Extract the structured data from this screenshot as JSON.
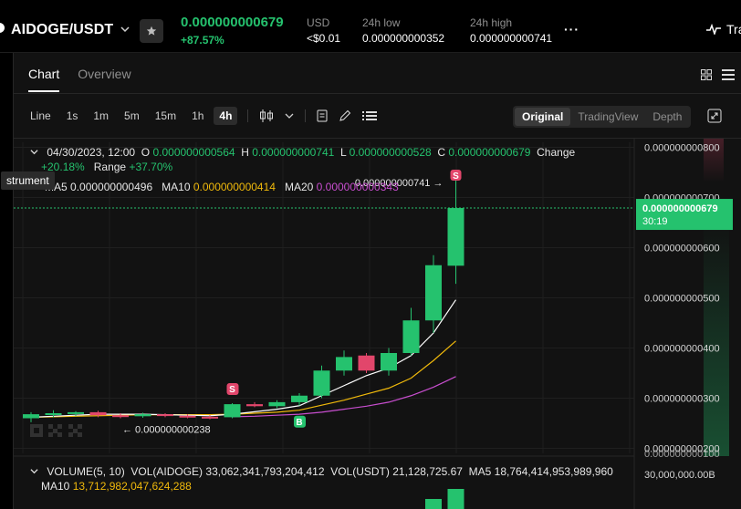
{
  "ticker": {
    "pair": "AIDOGE/USDT",
    "last_price": "0.000000000679",
    "change_pct": "+87.57%",
    "usd_label": "USD",
    "usd_value": "<$0.01",
    "low_label": "24h low",
    "low_value": "0.000000000352",
    "high_label": "24h high",
    "high_value": "0.000000000741",
    "more": "···",
    "trade_label": "Tra"
  },
  "tabs": [
    {
      "label": "Chart"
    },
    {
      "label": "Overview"
    }
  ],
  "toolbar": {
    "timeframes": [
      "Line",
      "1s",
      "1m",
      "5m",
      "15m",
      "1h",
      "4h"
    ],
    "active_timeframe": "4h"
  },
  "views": {
    "items": [
      "Original",
      "TradingView",
      "Depth"
    ],
    "active": "Original"
  },
  "legend": {
    "date": "04/30/2023, 12:00",
    "o_label": "O",
    "o_value": "0.000000000564",
    "h_label": "H",
    "h_value": "0.000000000741",
    "l_label": "L",
    "l_value": "0.000000000528",
    "c_label": "C",
    "c_value": "0.000000000679",
    "change_label": "Change",
    "change_value": "+20.18%",
    "range_label": "Range",
    "range_value": "+37.70%",
    "ma5_label": "MA5",
    "ma5_value": "0.000000000496",
    "ma10_label": "MA10",
    "ma10_value": "0.000000000414",
    "ma20_label": "MA20",
    "ma20_value": "0.000000000343",
    "tooltip": "strument"
  },
  "annotations": {
    "high_marker": "0.000000000741 →",
    "low_marker": "← 0.000000000238",
    "sell_tag": "S",
    "buy_tag": "B"
  },
  "price_axis": {
    "ticks": [
      "0.000000000800",
      "0.000000000700",
      "0.000000000600",
      "0.000000000500",
      "0.000000000400",
      "0.000000000300",
      "0.000000000200"
    ],
    "current_price": "0.000000000679",
    "countdown": "30:19",
    "cut_tick": "0.000000000100"
  },
  "volume": {
    "title": "VOLUME(5, 10)",
    "vol_coin_label": "VOL(AIDOGE)",
    "vol_coin_value": "33,062,341,793,204,412",
    "vol_usdt_label": "VOL(USDT)",
    "vol_usdt_value": "21,128,725.67",
    "ma5_label": "MA5",
    "ma5_value": "18,764,414,953,989,960",
    "ma10_label": "MA10",
    "ma10_value": "13,712,982,047,624,288",
    "axis_tick": "30,000,000.00B"
  },
  "colors": {
    "up": "#25c26e",
    "down": "#e2466b",
    "ma5": "#ffffff",
    "ma10": "#f0b90b",
    "ma20": "#c84ecf",
    "grid": "#1f1f1f"
  },
  "chart_data": {
    "type": "candlestick",
    "interval": "4h",
    "candles": [
      {
        "o": 2.6e-10,
        "h": 2.72e-10,
        "l": 2.52e-10,
        "c": 2.68e-10
      },
      {
        "o": 2.68e-10,
        "h": 2.76e-10,
        "l": 2.62e-10,
        "c": 2.7e-10
      },
      {
        "o": 2.7e-10,
        "h": 2.74e-10,
        "l": 2.64e-10,
        "c": 2.72e-10
      },
      {
        "o": 2.72e-10,
        "h": 2.75e-10,
        "l": 2.62e-10,
        "c": 2.66e-10
      },
      {
        "o": 2.66e-10,
        "h": 2.7e-10,
        "l": 2.6e-10,
        "c": 2.64e-10
      },
      {
        "o": 2.64e-10,
        "h": 2.71e-10,
        "l": 2.61e-10,
        "c": 2.68e-10
      },
      {
        "o": 2.68e-10,
        "h": 2.7e-10,
        "l": 2.62e-10,
        "c": 2.65e-10
      },
      {
        "o": 2.65e-10,
        "h": 2.68e-10,
        "l": 2.6e-10,
        "c": 2.63e-10
      },
      {
        "o": 2.63e-10,
        "h": 2.66e-10,
        "l": 2.58e-10,
        "c": 2.62e-10
      },
      {
        "o": 2.62e-10,
        "h": 2.9e-10,
        "l": 2.6e-10,
        "c": 2.88e-10
      },
      {
        "o": 2.88e-10,
        "h": 2.92e-10,
        "l": 2.82e-10,
        "c": 2.84e-10
      },
      {
        "o": 2.84e-10,
        "h": 2.96e-10,
        "l": 2.8e-10,
        "c": 2.92e-10
      },
      {
        "o": 2.92e-10,
        "h": 3.1e-10,
        "l": 2.85e-10,
        "c": 3.05e-10
      },
      {
        "o": 3.05e-10,
        "h": 3.65e-10,
        "l": 3e-10,
        "c": 3.55e-10
      },
      {
        "o": 3.55e-10,
        "h": 3.95e-10,
        "l": 3.45e-10,
        "c": 3.82e-10
      },
      {
        "o": 3.85e-10,
        "h": 3.9e-10,
        "l": 3.5e-10,
        "c": 3.55e-10
      },
      {
        "o": 3.55e-10,
        "h": 4e-10,
        "l": 3.45e-10,
        "c": 3.9e-10
      },
      {
        "o": 3.9e-10,
        "h": 4.8e-10,
        "l": 3.85e-10,
        "c": 4.55e-10
      },
      {
        "o": 4.55e-10,
        "h": 5.85e-10,
        "l": 4.3e-10,
        "c": 5.65e-10
      },
      {
        "o": 5.64e-10,
        "h": 7.41e-10,
        "l": 5.28e-10,
        "c": 6.79e-10
      }
    ],
    "ma5": [
      2.62e-10,
      2.64e-10,
      2.66e-10,
      2.68e-10,
      2.68e-10,
      2.68e-10,
      2.67e-10,
      2.66e-10,
      2.65e-10,
      2.68e-10,
      2.73e-10,
      2.78e-10,
      2.85e-10,
      3.05e-10,
      3.25e-10,
      3.45e-10,
      3.6e-10,
      3.85e-10,
      4.3e-10,
      4.96e-10
    ],
    "ma10": [
      2.62e-10,
      2.63e-10,
      2.64e-10,
      2.65e-10,
      2.66e-10,
      2.67e-10,
      2.67e-10,
      2.67e-10,
      2.67e-10,
      2.68e-10,
      2.7e-10,
      2.72e-10,
      2.76e-10,
      2.86e-10,
      2.96e-10,
      3.08e-10,
      3.2e-10,
      3.4e-10,
      3.75e-10,
      4.14e-10
    ],
    "ma20": [
      null,
      null,
      null,
      null,
      null,
      null,
      null,
      null,
      null,
      2.63e-10,
      2.64e-10,
      2.66e-10,
      2.68e-10,
      2.72e-10,
      2.78e-10,
      2.84e-10,
      2.92e-10,
      3.05e-10,
      3.22e-10,
      3.43e-10
    ],
    "volume": [
      0,
      0,
      0,
      0,
      0,
      0,
      0,
      0,
      0,
      0,
      0,
      0,
      0,
      0,
      0,
      0,
      0,
      0,
      0.5,
      1.0
    ],
    "ylim": [
      1.9e-10,
      8.1e-10
    ],
    "yticks": [
      8e-10,
      7e-10,
      6e-10,
      5e-10,
      4e-10,
      3e-10,
      2e-10
    ]
  }
}
